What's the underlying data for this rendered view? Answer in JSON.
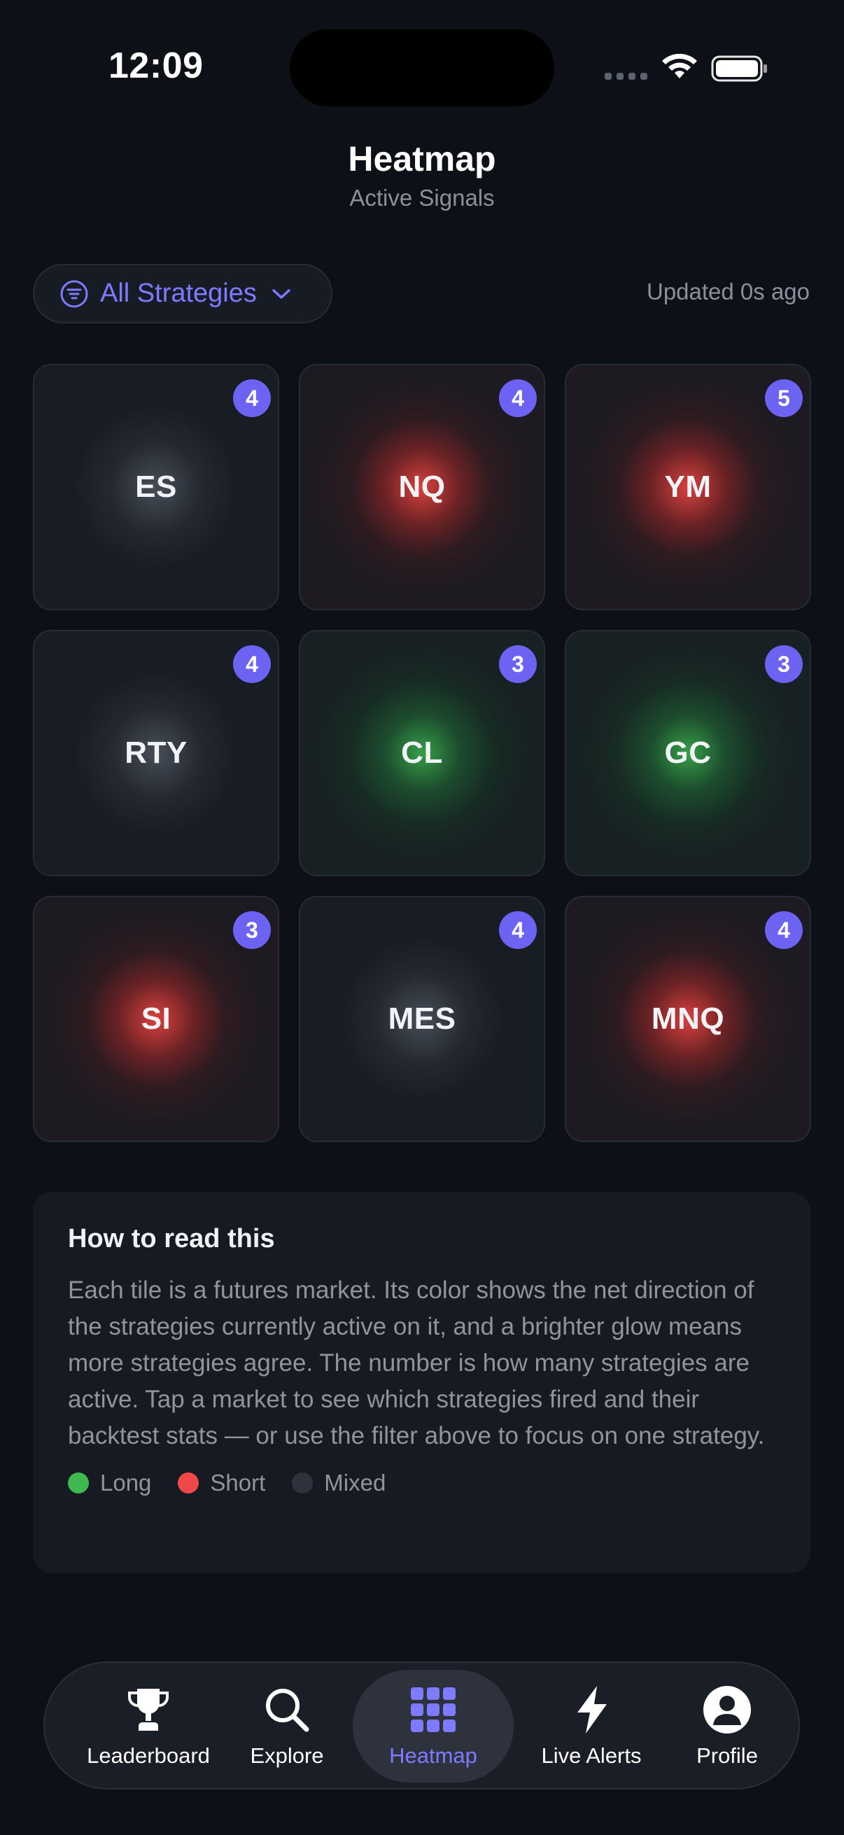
{
  "status_bar": {
    "time": "12:09"
  },
  "header": {
    "title": "Heatmap",
    "subtitle": "Active Signals"
  },
  "filter": {
    "label": "All Strategies",
    "icon": "filter-icon",
    "updated": "Updated 0s ago"
  },
  "colors": {
    "accent": "#6c63f2",
    "long": "#3fb950",
    "short": "#f04848",
    "mixed": "#2d323c"
  },
  "tiles": [
    {
      "symbol": "ES",
      "count": "4",
      "direction": "neutral"
    },
    {
      "symbol": "NQ",
      "count": "4",
      "direction": "short"
    },
    {
      "symbol": "YM",
      "count": "5",
      "direction": "short"
    },
    {
      "symbol": "RTY",
      "count": "4",
      "direction": "neutral"
    },
    {
      "symbol": "CL",
      "count": "3",
      "direction": "long"
    },
    {
      "symbol": "GC",
      "count": "3",
      "direction": "long"
    },
    {
      "symbol": "SI",
      "count": "3",
      "direction": "short"
    },
    {
      "symbol": "MES",
      "count": "4",
      "direction": "neutral"
    },
    {
      "symbol": "MNQ",
      "count": "4",
      "direction": "short"
    }
  ],
  "info": {
    "title": "How to read this",
    "body": "Each tile is a futures market. Its color shows the net direction of the strategies currently active on it, and a brighter glow means more strategies agree. The number is how many strategies are active. Tap a market to see which strategies fired and their backtest stats — or use the filter above to focus on one strategy.",
    "legend": [
      {
        "label": "Long",
        "color": "#3fb950"
      },
      {
        "label": "Short",
        "color": "#f04848"
      },
      {
        "label": "Mixed",
        "color": "#2d323c"
      }
    ]
  },
  "tabs": [
    {
      "label": "Leaderboard",
      "icon": "trophy-icon"
    },
    {
      "label": "Explore",
      "icon": "search-icon"
    },
    {
      "label": "Heatmap",
      "icon": "grid-icon",
      "active": true
    },
    {
      "label": "Live Alerts",
      "icon": "bolt-icon"
    },
    {
      "label": "Profile",
      "icon": "person-icon"
    }
  ]
}
